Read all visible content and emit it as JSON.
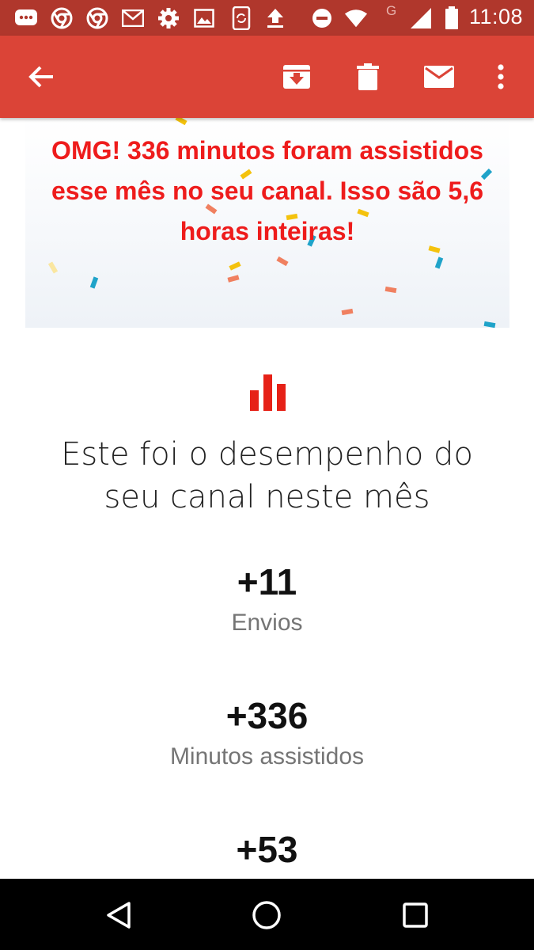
{
  "status_bar": {
    "time": "11:08",
    "network_letter": "G",
    "icons": [
      "messages-icon",
      "chrome-icon",
      "chrome-icon",
      "gmail-icon",
      "settings-icon",
      "gallery-icon",
      "phone-sync-icon",
      "upload-icon",
      "do-not-disturb-icon",
      "wifi-icon",
      "signal-icon",
      "battery-icon"
    ]
  },
  "app_bar": {
    "icons": [
      "back-arrow-icon",
      "archive-icon",
      "delete-icon",
      "mark-unread-icon",
      "more-vert-icon"
    ],
    "background_color": "#db4437"
  },
  "email": {
    "banner_text": "OMG! 336 minutos foram assistidos esse mês no seu canal. Isso são 5,6 horas inteiras!",
    "banner_color": "#ee1c1c",
    "section_icon": "bar-chart-icon",
    "performance_title": "Este foi o desempenho do seu canal neste mês",
    "stats": [
      {
        "value": "+11",
        "label": "Envios"
      },
      {
        "value": "+336",
        "label": "Minutos assistidos"
      },
      {
        "value": "+53",
        "label": ""
      }
    ]
  },
  "nav_bar": {
    "icons": [
      "back-triangle-icon",
      "home-circle-icon",
      "recents-square-icon"
    ]
  }
}
